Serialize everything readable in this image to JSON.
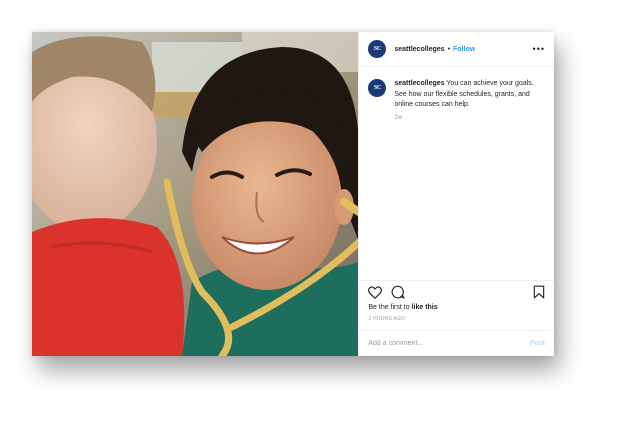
{
  "post": {
    "account": {
      "username": "seattlecolleges",
      "avatar_text": "SC",
      "follow_label": "Follow",
      "separator": "•",
      "more_label": "•••"
    },
    "caption": {
      "username": "seattlecolleges",
      "text": "You can achieve your goals. See how our flexible schedules, grants, and online courses can help."
    },
    "caption_age": "2w",
    "actions": {
      "like_icon": "heart-icon",
      "comment_icon": "comment-icon",
      "save_icon": "bookmark-icon"
    },
    "likes": {
      "prefix": "Be the first to",
      "action": "like this"
    },
    "timestamp": "2 HOURS AGO",
    "comment_box": {
      "placeholder": "Add a comment...",
      "post_label": "Post"
    },
    "image": {
      "description_icon": "photo-woman-stethoscope"
    }
  },
  "colors": {
    "link_blue": "#3897f0",
    "post_disabled": "#b2dffc",
    "avatar_bg": "#1b3a78"
  }
}
